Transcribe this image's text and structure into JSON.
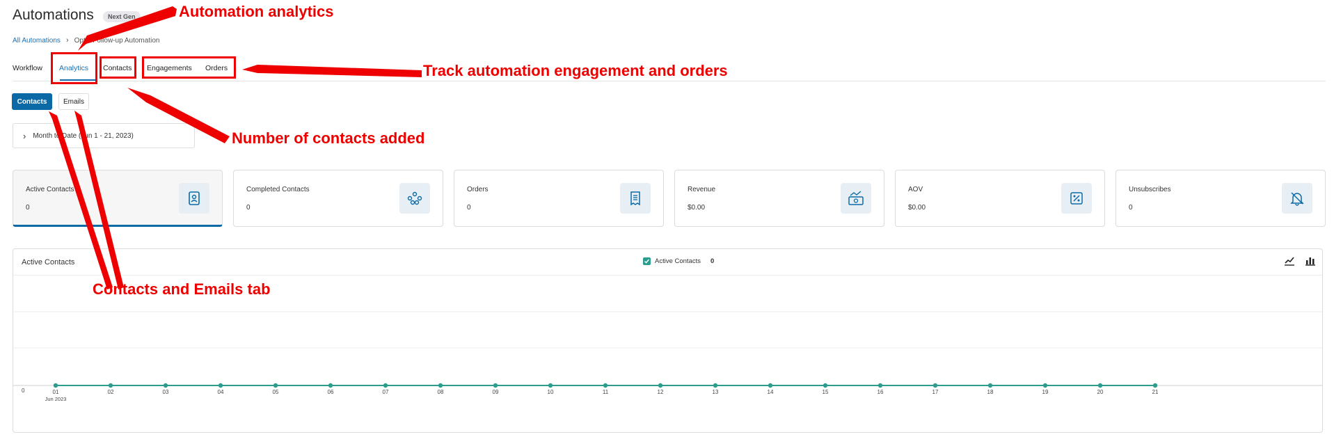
{
  "header": {
    "title": "Automations",
    "badge": "Next Gen"
  },
  "breadcrumb": {
    "parent": "All Automations",
    "current": "Optin Follow-up Automation"
  },
  "tabs": [
    {
      "label": "Workflow",
      "active": false
    },
    {
      "label": "Analytics",
      "active": true
    },
    {
      "label": "Contacts",
      "active": false
    },
    {
      "label": "Engagements",
      "active": false
    },
    {
      "label": "Orders",
      "active": false
    }
  ],
  "subtabs": {
    "contacts": "Contacts",
    "emails": "Emails"
  },
  "date_range": {
    "label": "Month to Date (Jun 1 - 21, 2023)"
  },
  "kpis": [
    {
      "label": "Active Contacts",
      "value": "0",
      "icon": "contact-book-icon"
    },
    {
      "label": "Completed Contacts",
      "value": "0",
      "icon": "people-network-icon"
    },
    {
      "label": "Orders",
      "value": "0",
      "icon": "receipt-icon"
    },
    {
      "label": "Revenue",
      "value": "$0.00",
      "icon": "money-trend-icon"
    },
    {
      "label": "AOV",
      "value": "$0.00",
      "icon": "percent-icon"
    },
    {
      "label": "Unsubscribes",
      "value": "0",
      "icon": "bell-off-icon"
    }
  ],
  "chart": {
    "title": "Active Contacts",
    "legend_label": "Active Contacts",
    "legend_value": "0"
  },
  "chart_data": {
    "type": "line",
    "title": "Active Contacts",
    "xlabel": "Jun 2023",
    "ylabel": "",
    "x": [
      "01",
      "02",
      "03",
      "04",
      "05",
      "06",
      "07",
      "08",
      "09",
      "10",
      "11",
      "12",
      "13",
      "14",
      "15",
      "16",
      "17",
      "18",
      "19",
      "20",
      "21"
    ],
    "series": [
      {
        "name": "Active Contacts",
        "values": [
          0,
          0,
          0,
          0,
          0,
          0,
          0,
          0,
          0,
          0,
          0,
          0,
          0,
          0,
          0,
          0,
          0,
          0,
          0,
          0,
          0
        ]
      }
    ],
    "y_ticks": [
      "0"
    ],
    "grid": true,
    "legend_placement": "top-center"
  },
  "annotations": {
    "analytics": "Automation analytics",
    "track": "Track automation engagement and orders",
    "contacts_added": "Number of contacts added",
    "tabs": "Contacts and Emails tab"
  },
  "colors": {
    "accent": "#0b6aa6",
    "series": "#2a9d8f",
    "annotation": "#ee0000"
  }
}
